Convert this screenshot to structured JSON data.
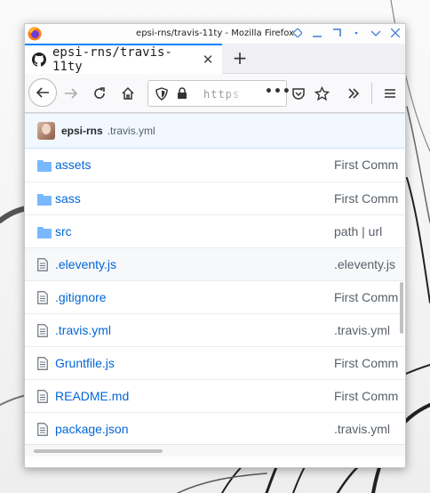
{
  "window": {
    "title": "epsi-rns/travis-11ty - Mozilla Firefox"
  },
  "tab": {
    "label": "epsi-rns/travis-11ty"
  },
  "urlbar": {
    "text": "https"
  },
  "commit": {
    "author": "epsi-rns",
    "message": ".travis.yml"
  },
  "files": [
    {
      "type": "folder",
      "name": "assets",
      "message": "First Comm"
    },
    {
      "type": "folder",
      "name": "sass",
      "message": "First Comm"
    },
    {
      "type": "folder",
      "name": "src",
      "message": "path | url"
    },
    {
      "type": "file",
      "name": ".eleventy.js",
      "message": ".eleventy.js"
    },
    {
      "type": "file",
      "name": ".gitignore",
      "message": "First Comm"
    },
    {
      "type": "file",
      "name": ".travis.yml",
      "message": ".travis.yml"
    },
    {
      "type": "file",
      "name": "Gruntfile.js",
      "message": "First Comm"
    },
    {
      "type": "file",
      "name": "README.md",
      "message": "First Comm"
    },
    {
      "type": "file",
      "name": "package.json",
      "message": ".travis.yml"
    }
  ],
  "colors": {
    "link": "#0366d6",
    "accent": "#0a84ff",
    "commit_bar": "#f1f8ff"
  }
}
